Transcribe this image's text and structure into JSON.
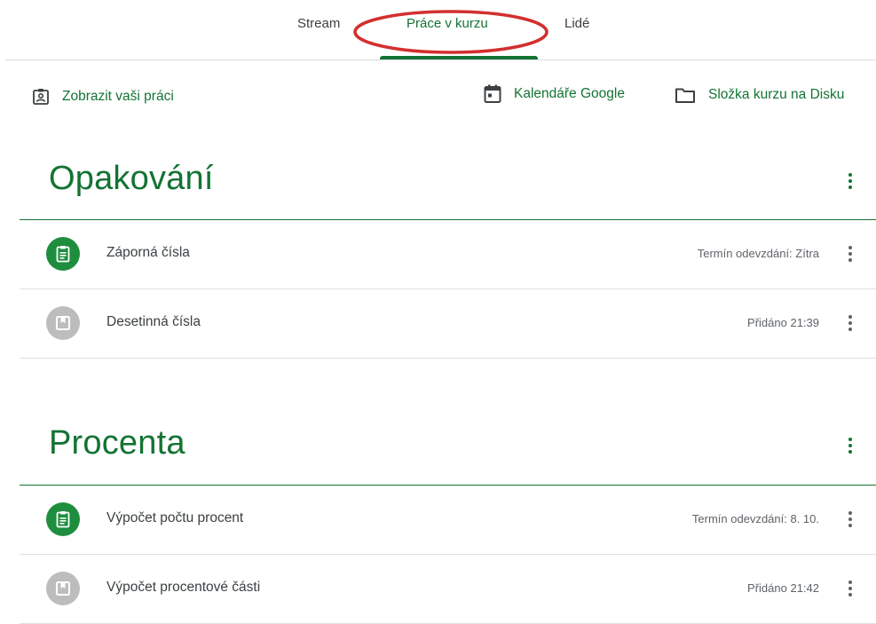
{
  "nav": {
    "tabs": [
      {
        "label": "Stream",
        "active": false
      },
      {
        "label": "Práce v kurzu",
        "active": true
      },
      {
        "label": "Lidé",
        "active": false
      }
    ]
  },
  "actions": {
    "view_work": "Zobrazit vaši práci",
    "calendar": "Kalendáře Google",
    "drive_folder": "Složka kurzu na Disku"
  },
  "topics": [
    {
      "title": "Opakování",
      "items": [
        {
          "title": "Záporná čísla",
          "meta": "Termín odevzdání: Zítra",
          "icon": "assignment-icon",
          "status": "green"
        },
        {
          "title": "Desetinná čísla",
          "meta": "Přidáno 21:39",
          "icon": "material-icon",
          "status": "grey"
        }
      ]
    },
    {
      "title": "Procenta",
      "items": [
        {
          "title": "Výpočet počtu procent",
          "meta": "Termín odevzdání: 8. 10.",
          "icon": "assignment-icon",
          "status": "green"
        },
        {
          "title": "Výpočet procentové části",
          "meta": "Přidáno 21:42",
          "icon": "material-icon",
          "status": "grey"
        }
      ]
    }
  ],
  "colors": {
    "accent": "#137333",
    "assignment_icon_bg": "#1e8e3e",
    "material_icon_bg": "#bdbdbd",
    "annotation": "#d32f2f",
    "divider": "#dadce0"
  }
}
